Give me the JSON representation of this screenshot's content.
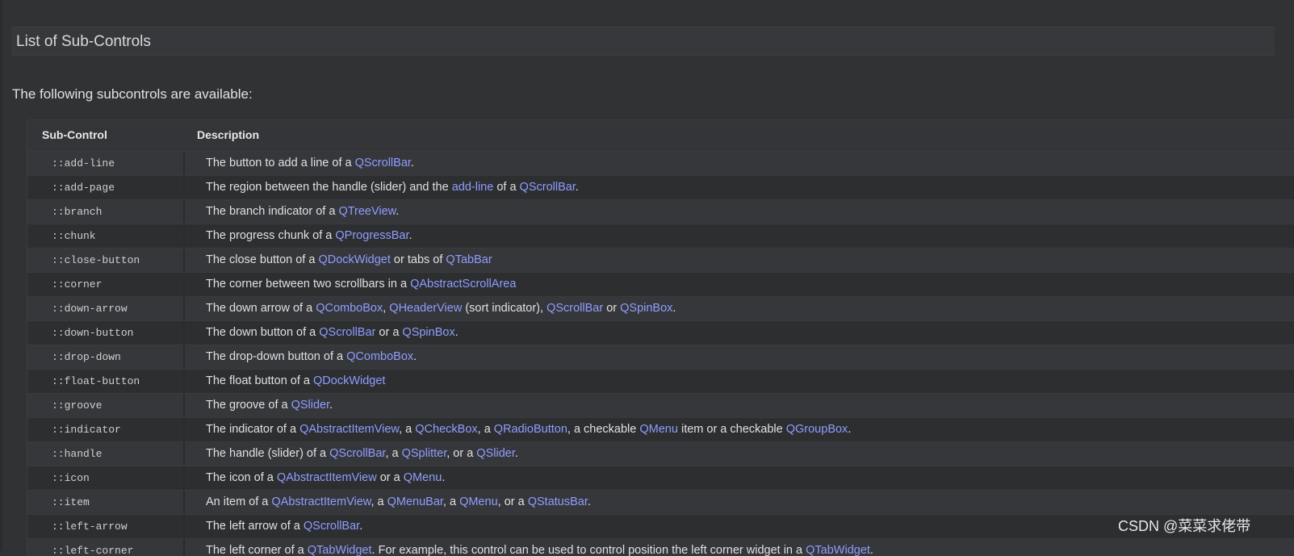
{
  "section": {
    "title": "List of Sub-Controls"
  },
  "intro": "The following subcontrols are available:",
  "table": {
    "headers": [
      "Sub-Control",
      "Description"
    ],
    "rows": [
      {
        "sub": "::add-line",
        "desc": [
          [
            "The button to add a line of a ",
            0
          ],
          [
            "QScrollBar",
            1
          ],
          [
            ".",
            0
          ]
        ]
      },
      {
        "sub": "::add-page",
        "desc": [
          [
            "The region between the handle (slider) and the ",
            0
          ],
          [
            "add-line",
            1
          ],
          [
            " of a ",
            0
          ],
          [
            "QScrollBar",
            1
          ],
          [
            ".",
            0
          ]
        ]
      },
      {
        "sub": "::branch",
        "desc": [
          [
            "The branch indicator of a ",
            0
          ],
          [
            "QTreeView",
            1
          ],
          [
            ".",
            0
          ]
        ]
      },
      {
        "sub": "::chunk",
        "desc": [
          [
            "The progress chunk of a ",
            0
          ],
          [
            "QProgressBar",
            1
          ],
          [
            ".",
            0
          ]
        ]
      },
      {
        "sub": "::close-button",
        "desc": [
          [
            "The close button of a ",
            0
          ],
          [
            "QDockWidget",
            1
          ],
          [
            " or tabs of ",
            0
          ],
          [
            "QTabBar",
            1
          ]
        ]
      },
      {
        "sub": "::corner",
        "desc": [
          [
            "The corner between two scrollbars in a ",
            0
          ],
          [
            "QAbstractScrollArea",
            1
          ]
        ]
      },
      {
        "sub": "::down-arrow",
        "desc": [
          [
            "The down arrow of a ",
            0
          ],
          [
            "QComboBox",
            1
          ],
          [
            ", ",
            0
          ],
          [
            "QHeaderView",
            1
          ],
          [
            " (sort indicator), ",
            0
          ],
          [
            "QScrollBar",
            1
          ],
          [
            " or ",
            0
          ],
          [
            "QSpinBox",
            1
          ],
          [
            ".",
            0
          ]
        ]
      },
      {
        "sub": "::down-button",
        "desc": [
          [
            "The down button of a ",
            0
          ],
          [
            "QScrollBar",
            1
          ],
          [
            " or a ",
            0
          ],
          [
            "QSpinBox",
            1
          ],
          [
            ".",
            0
          ]
        ]
      },
      {
        "sub": "::drop-down",
        "desc": [
          [
            "The drop-down button of a ",
            0
          ],
          [
            "QComboBox",
            1
          ],
          [
            ".",
            0
          ]
        ]
      },
      {
        "sub": "::float-button",
        "desc": [
          [
            "The float button of a ",
            0
          ],
          [
            "QDockWidget",
            1
          ]
        ]
      },
      {
        "sub": "::groove",
        "desc": [
          [
            "The groove of a ",
            0
          ],
          [
            "QSlider",
            1
          ],
          [
            ".",
            0
          ]
        ]
      },
      {
        "sub": "::indicator",
        "desc": [
          [
            "The indicator of a ",
            0
          ],
          [
            "QAbstractItemView",
            1
          ],
          [
            ", a ",
            0
          ],
          [
            "QCheckBox",
            1
          ],
          [
            ", a ",
            0
          ],
          [
            "QRadioButton",
            1
          ],
          [
            ", a checkable ",
            0
          ],
          [
            "QMenu",
            1
          ],
          [
            " item or a checkable ",
            0
          ],
          [
            "QGroupBox",
            1
          ],
          [
            ".",
            0
          ]
        ]
      },
      {
        "sub": "::handle",
        "desc": [
          [
            "The handle (slider) of a ",
            0
          ],
          [
            "QScrollBar",
            1
          ],
          [
            ", a ",
            0
          ],
          [
            "QSplitter",
            1
          ],
          [
            ", or a ",
            0
          ],
          [
            "QSlider",
            1
          ],
          [
            ".",
            0
          ]
        ]
      },
      {
        "sub": "::icon",
        "desc": [
          [
            "The icon of a ",
            0
          ],
          [
            "QAbstractItemView",
            1
          ],
          [
            " or a ",
            0
          ],
          [
            "QMenu",
            1
          ],
          [
            ".",
            0
          ]
        ]
      },
      {
        "sub": "::item",
        "desc": [
          [
            "An item of a ",
            0
          ],
          [
            "QAbstractItemView",
            1
          ],
          [
            ", a ",
            0
          ],
          [
            "QMenuBar",
            1
          ],
          [
            ", a ",
            0
          ],
          [
            "QMenu",
            1
          ],
          [
            ", or a ",
            0
          ],
          [
            "QStatusBar",
            1
          ],
          [
            ".",
            0
          ]
        ]
      },
      {
        "sub": "::left-arrow",
        "desc": [
          [
            "The left arrow of a ",
            0
          ],
          [
            "QScrollBar",
            1
          ],
          [
            ".",
            0
          ]
        ]
      },
      {
        "sub": "::left-corner",
        "desc": [
          [
            "The left corner of a ",
            0
          ],
          [
            "QTabWidget",
            1
          ],
          [
            ". For example, this control can be used to control position the left corner widget in a ",
            0
          ],
          [
            "QTabWidget",
            1
          ],
          [
            ".",
            0
          ]
        ]
      }
    ]
  },
  "watermark": "CSDN @菜菜求佬带",
  "colors": {
    "link": "#8f9dff",
    "background": "#313234"
  }
}
